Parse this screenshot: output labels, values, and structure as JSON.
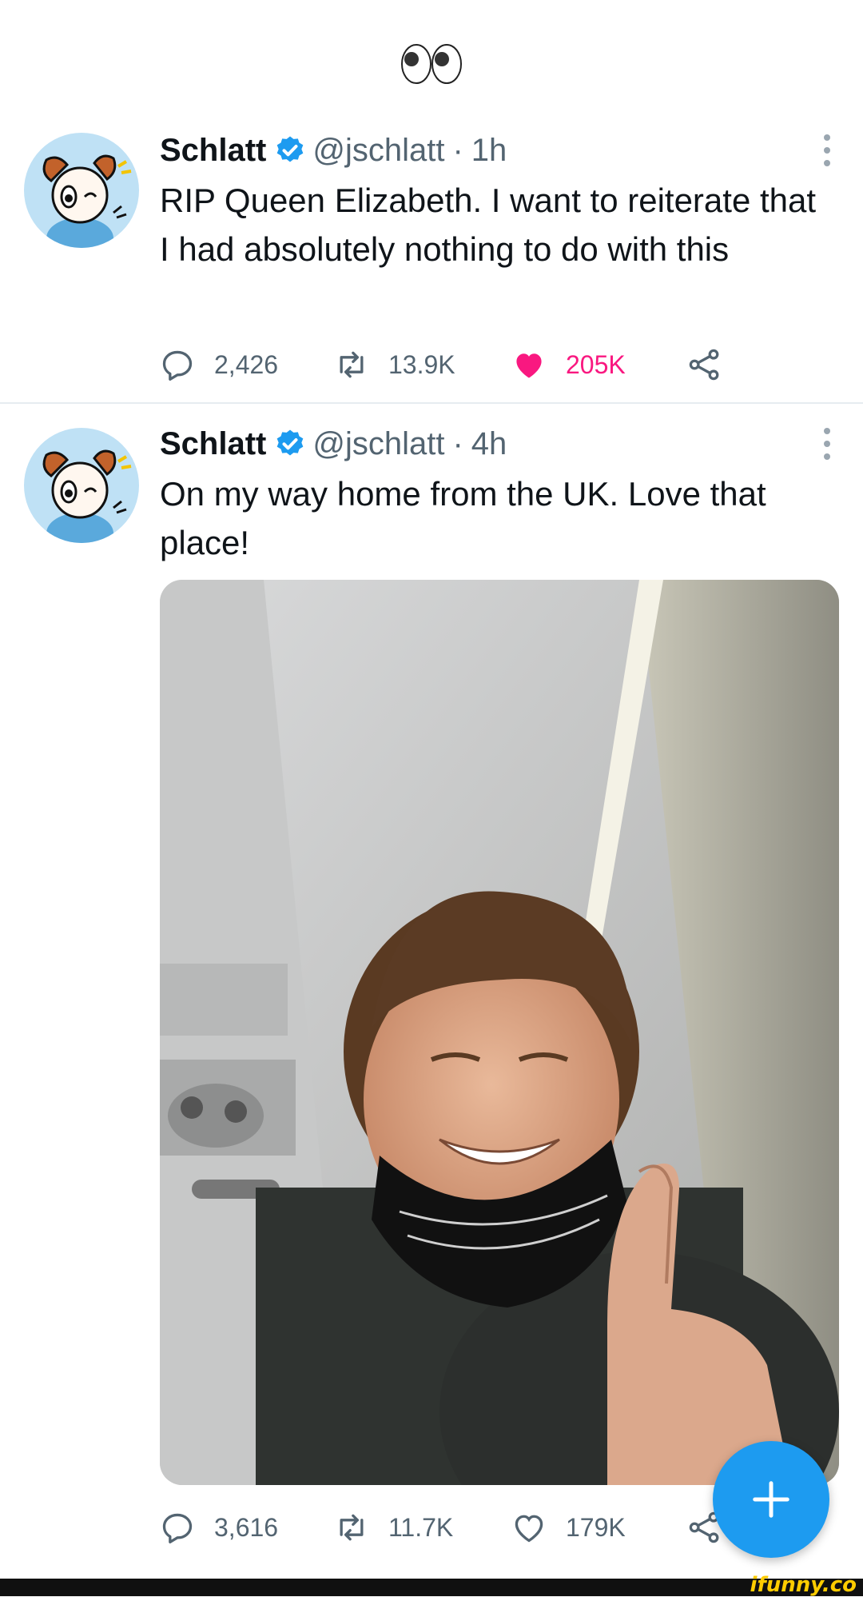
{
  "top_emoji": "👀",
  "tweets": [
    {
      "name": "Schlatt",
      "handle": "@jschlatt",
      "separator": "·",
      "time": "1h",
      "text": "RIP Queen Elizabeth. I want to reiterate that I had absolutely nothing to do with this",
      "replies": "2,426",
      "retweets": "13.9K",
      "likes": "205K",
      "liked": true
    },
    {
      "name": "Schlatt",
      "handle": "@jschlatt",
      "separator": "·",
      "time": "4h",
      "text": "On my way home from the UK. Love that place!",
      "replies": "3,616",
      "retweets": "11.7K",
      "likes": "179K",
      "liked": false,
      "media": "selfie-photo"
    }
  ],
  "icons": {
    "verified": "verified-badge-icon",
    "more": "more-vertical-icon",
    "reply": "reply-icon",
    "retweet": "retweet-icon",
    "like": "heart-icon",
    "share": "share-icon",
    "compose": "plus-icon"
  },
  "colors": {
    "verified": "#1d9bf0",
    "liked": "#f91880",
    "muted": "#536471",
    "fab": "#1d9bf0"
  },
  "watermark": "ifunny.co"
}
